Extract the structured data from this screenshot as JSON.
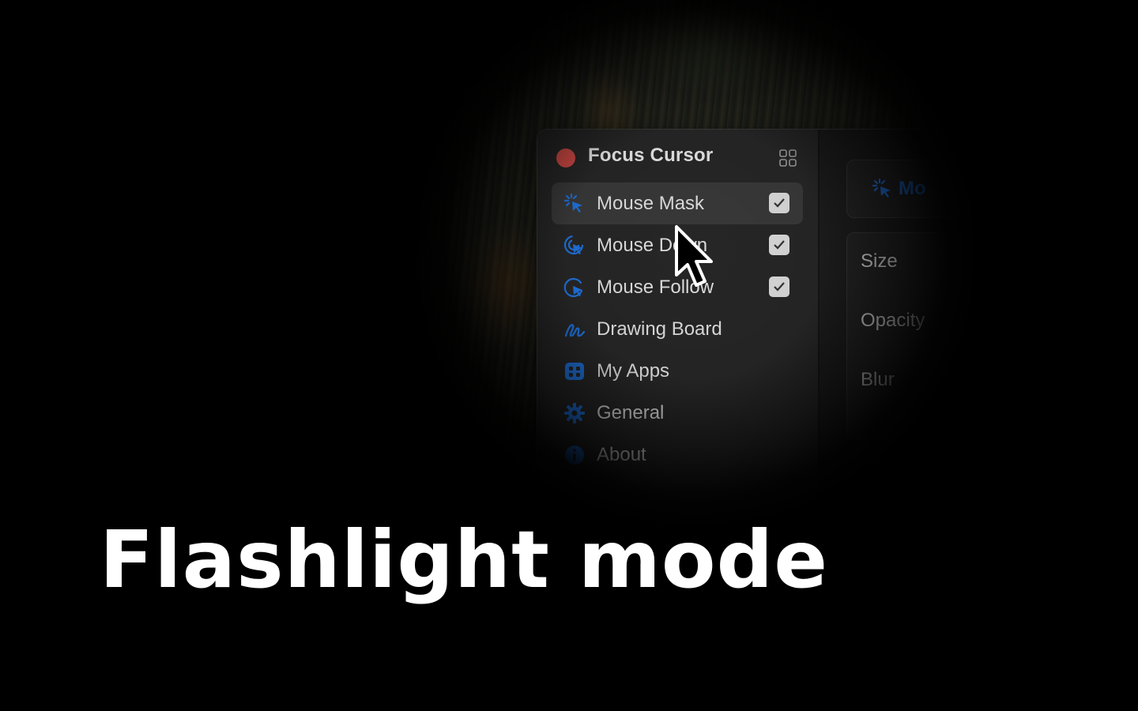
{
  "app": {
    "title": "Focus Cursor",
    "close_color": "#d04a45",
    "accent_color": "#1f6fd6"
  },
  "sidebar": {
    "items": [
      {
        "label": "Mouse Mask",
        "icon": "mouse-mask-icon",
        "checked": true,
        "selected": true
      },
      {
        "label": "Mouse Down",
        "icon": "mouse-down-icon",
        "checked": true,
        "selected": false
      },
      {
        "label": "Mouse Follow",
        "icon": "mouse-follow-icon",
        "checked": true,
        "selected": false
      },
      {
        "label": "Drawing Board",
        "icon": "drawing-board-icon",
        "checked": false,
        "selected": false
      },
      {
        "label": "My Apps",
        "icon": "my-apps-icon",
        "checked": false,
        "selected": false
      },
      {
        "label": "General",
        "icon": "gear-icon",
        "checked": false,
        "selected": false
      },
      {
        "label": "About",
        "icon": "info-icon",
        "checked": false,
        "selected": false
      }
    ]
  },
  "content": {
    "feature_title": "Mo",
    "settings": [
      "Size",
      "Opacity",
      "Blur"
    ]
  },
  "caption": "Flashlight mode"
}
